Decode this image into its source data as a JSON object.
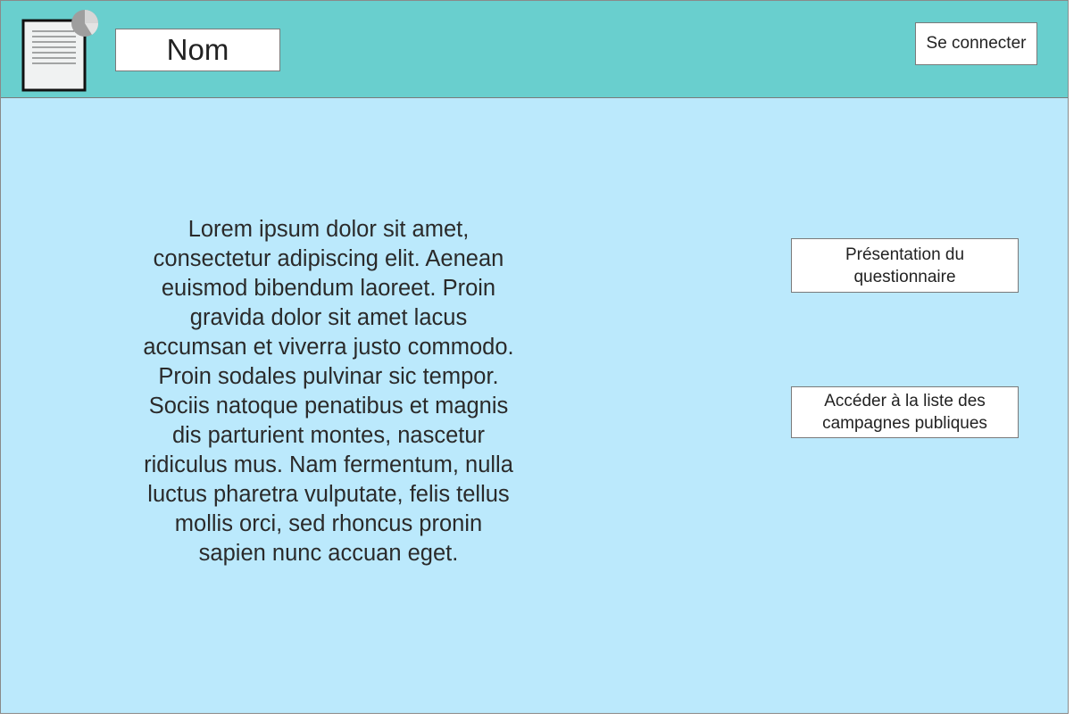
{
  "header": {
    "logo_icon": "document-with-pie-chart-icon",
    "name_label": "Nom",
    "login_label": "Se connecter"
  },
  "main": {
    "description": "Lorem ipsum dolor sit amet, consectetur adipiscing elit. Aenean euismod bibendum laoreet. Proin gravida dolor sit amet lacus accumsan et viverra justo commodo. Proin sodales pulvinar sic tempor. Sociis natoque penatibus et magnis dis parturient montes, nascetur ridiculus mus. Nam fermentum, nulla luctus pharetra vulputate, felis tellus mollis orci, sed rhoncus pronin sapien nunc accuan eget."
  },
  "actions": {
    "presentation_label": "Présentation du questionnaire",
    "campagnes_label": "Accéder à la liste des campagnes publiques"
  },
  "colors": {
    "header_bg": "#69cfce",
    "content_bg": "#bbe9fc",
    "box_bg": "#ffffff",
    "border": "#7a7a7a",
    "text": "#222222"
  }
}
